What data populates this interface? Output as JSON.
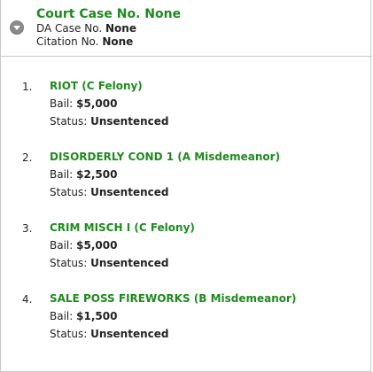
{
  "case": {
    "title": "Court Case No. None",
    "da_label": "DA Case No.",
    "da_value": "None",
    "citation_label": "Citation No.",
    "citation_value": "None"
  },
  "labels": {
    "bail": "Bail:",
    "status": "Status:"
  },
  "charges": [
    {
      "number": "1.",
      "name": "RIOT (C Felony)",
      "bail": "$5,000",
      "status": "Unsentenced"
    },
    {
      "number": "2.",
      "name": "DISORDERLY COND 1 (A Misdemeanor)",
      "bail": "$2,500",
      "status": "Unsentenced"
    },
    {
      "number": "3.",
      "name": "CRIM MISCH I (C Felony)",
      "bail": "$5,000",
      "status": "Unsentenced"
    },
    {
      "number": "4.",
      "name": "SALE POSS FIREWORKS (B Misdemeanor)",
      "bail": "$1,500",
      "status": "Unsentenced"
    }
  ],
  "colors": {
    "accent_green": "#1f8a1f",
    "border": "#c9c9c9",
    "toggle_gray": "#8a8a8a"
  },
  "icons": {
    "toggle": "chevron-down-circle-icon"
  }
}
